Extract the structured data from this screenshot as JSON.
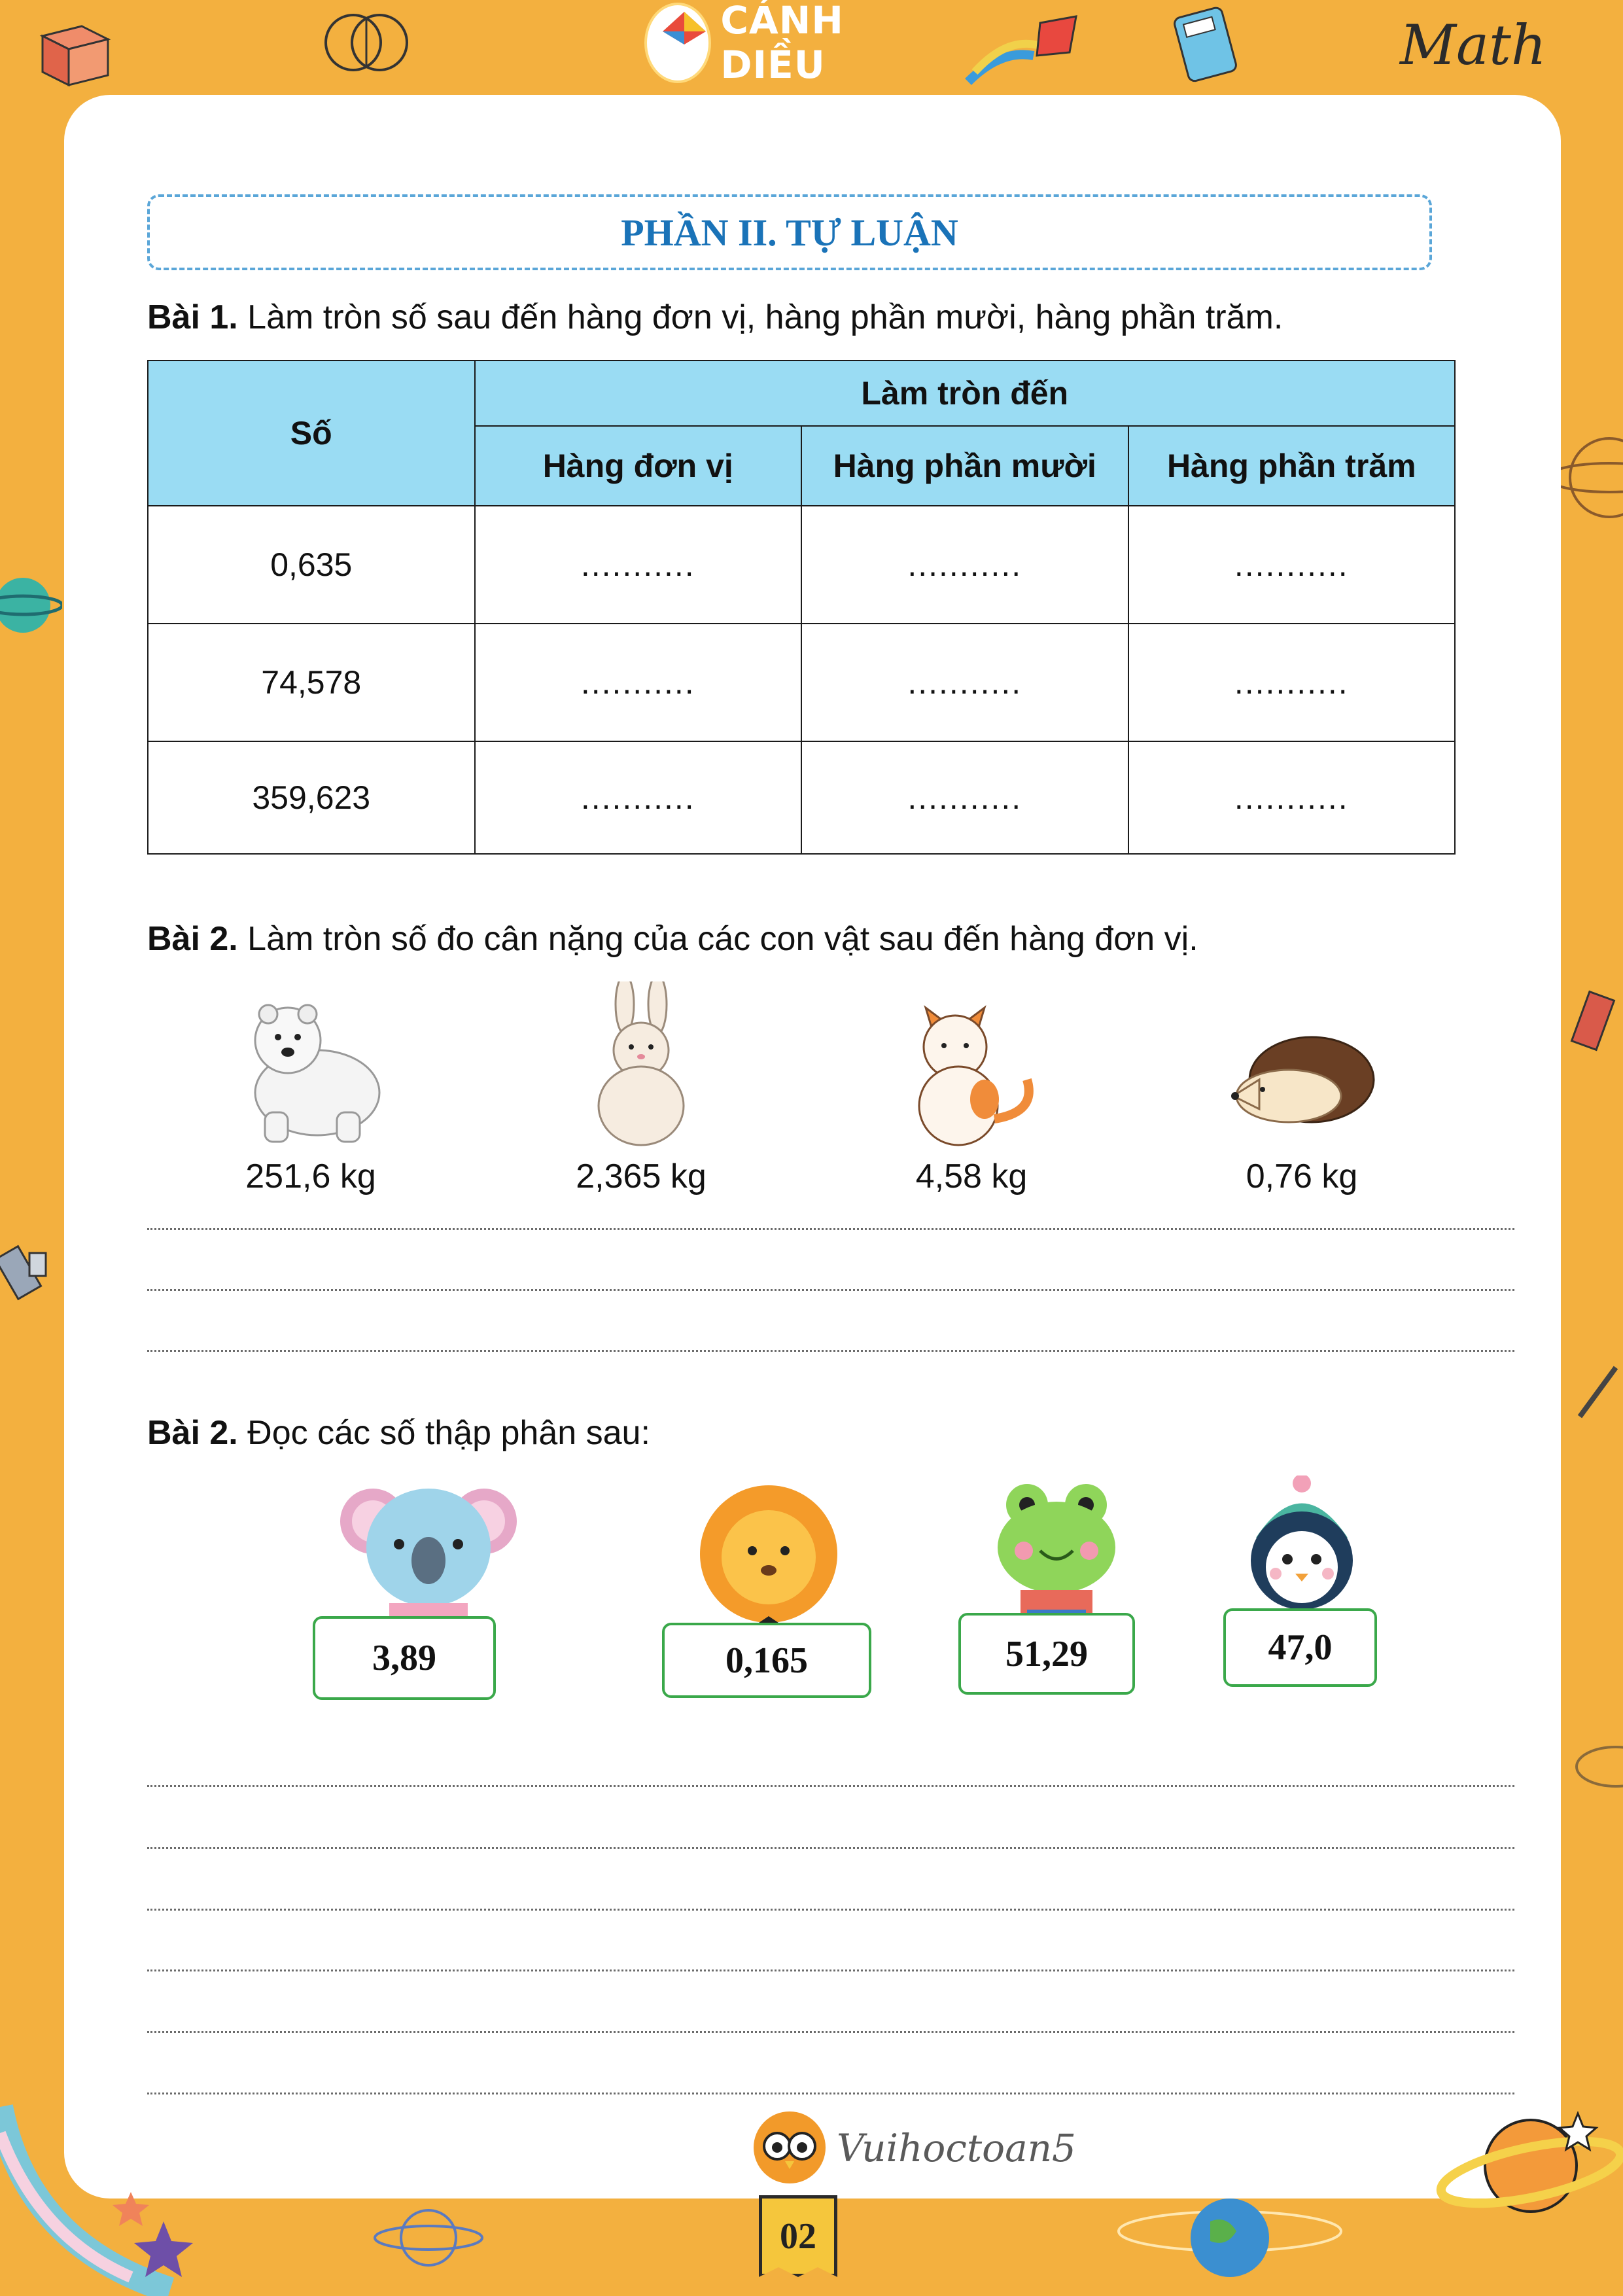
{
  "header": {
    "brand": "CÁNH DIỀU",
    "brand_logo_text": "Cánh Diều",
    "math_label": "Math"
  },
  "section_title": "PHẦN II. TỰ LUẬN",
  "task1": {
    "label": "Bài 1.",
    "text": " Làm tròn số sau đến hàng đơn vị, hàng phần mười, hàng phần trăm.",
    "table": {
      "col_number": "Số",
      "col_group": "Làm tròn đến",
      "sub_cols": [
        "Hàng đơn vị",
        "Hàng phần mười",
        "Hàng phần trăm"
      ],
      "rows": [
        {
          "number": "0,635",
          "cells": [
            "...........",
            "...........",
            "..........."
          ]
        },
        {
          "number": "74,578",
          "cells": [
            "...........",
            "...........",
            "..........."
          ]
        },
        {
          "number": "359,623",
          "cells": [
            "...........",
            "...........",
            "..........."
          ]
        }
      ]
    }
  },
  "task2": {
    "label": "Bài 2.",
    "text": " Làm tròn số đo cân nặng của các con vật sau đến hàng đơn vị.",
    "animals": [
      {
        "icon": "polar-bear-icon",
        "weight": "251,6 kg"
      },
      {
        "icon": "rabbit-icon",
        "weight": "2,365 kg"
      },
      {
        "icon": "cat-icon",
        "weight": "4,58 kg"
      },
      {
        "icon": "hedgehog-icon",
        "weight": "0,76 kg"
      }
    ]
  },
  "task3": {
    "label": "Bài 2.",
    "text": " Đọc các số thập phân sau:",
    "items": [
      {
        "icon": "koala-icon",
        "number": "3,89"
      },
      {
        "icon": "lion-icon",
        "number": "0,165"
      },
      {
        "icon": "frog-icon",
        "number": "51,29"
      },
      {
        "icon": "penguin-icon",
        "number": "47,0"
      }
    ]
  },
  "footer": {
    "brand": "Vuihoctoan5",
    "page": "02"
  },
  "colors": {
    "background": "#f3b03f",
    "title_blue": "#1a73b8",
    "table_header": "#9adcf3",
    "box_green": "#3aa84a"
  }
}
